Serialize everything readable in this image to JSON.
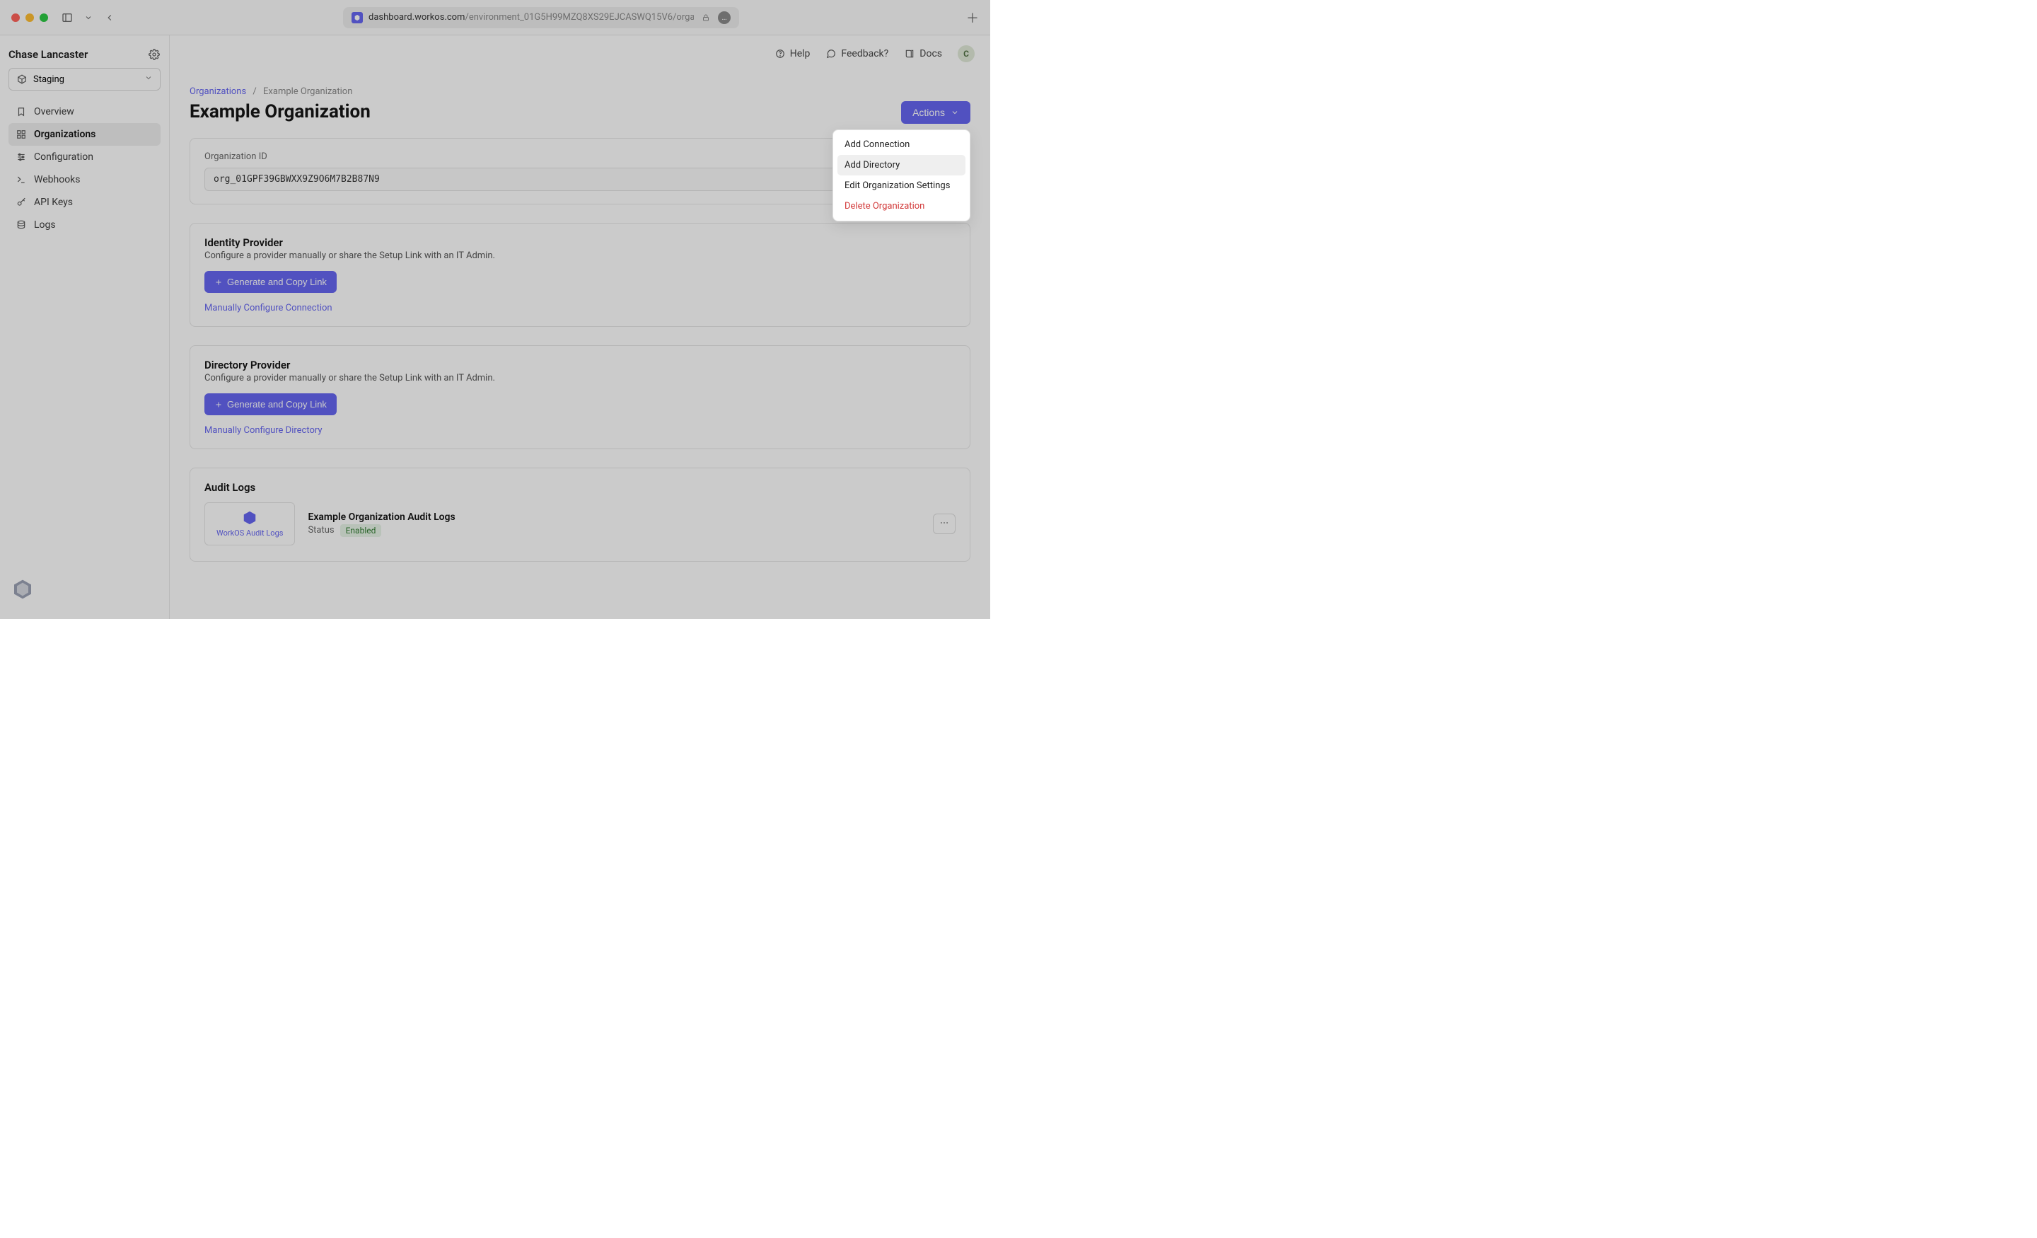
{
  "browser": {
    "url_dark": "dashboard.workos.com",
    "url_rest": "/environment_01G5H99MZQ8XS29EJCASWQ15V6/organiz"
  },
  "sidebar": {
    "workspace_name": "Chase Lancaster",
    "env_label": "Staging",
    "items": [
      {
        "label": "Overview",
        "icon": "bookmark-icon"
      },
      {
        "label": "Organizations",
        "icon": "grid-icon"
      },
      {
        "label": "Configuration",
        "icon": "sliders-icon"
      },
      {
        "label": "Webhooks",
        "icon": "terminal-icon"
      },
      {
        "label": "API Keys",
        "icon": "key-icon"
      },
      {
        "label": "Logs",
        "icon": "database-icon"
      }
    ]
  },
  "topbar": {
    "help": "Help",
    "feedback": "Feedback?",
    "docs": "Docs",
    "avatar_initial": "C"
  },
  "breadcrumbs": {
    "root": "Organizations",
    "sep": "/",
    "current": "Example Organization"
  },
  "page": {
    "title": "Example Organization",
    "actions_label": "Actions"
  },
  "dropdown": {
    "items": [
      "Add Connection",
      "Add Directory",
      "Edit Organization Settings",
      "Delete Organization"
    ]
  },
  "org_id": {
    "label": "Organization ID",
    "value": "org_01GPF39GBWXX9Z9O6M7B2B87N9"
  },
  "identity": {
    "title": "Identity Provider",
    "subtitle": "Configure a provider manually or share the Setup Link with an IT Admin.",
    "generate": "Generate and Copy Link",
    "manual": "Manually Configure Connection"
  },
  "directory": {
    "title": "Directory Provider",
    "subtitle": "Configure a provider manually or share the Setup Link with an IT Admin.",
    "generate": "Generate and Copy Link",
    "manual": "Manually Configure Directory"
  },
  "audit": {
    "section_title": "Audit Logs",
    "logo_label": "WorkOS Audit Logs",
    "entity_title": "Example Organization Audit Logs",
    "status_label": "Status",
    "status_value": "Enabled"
  }
}
